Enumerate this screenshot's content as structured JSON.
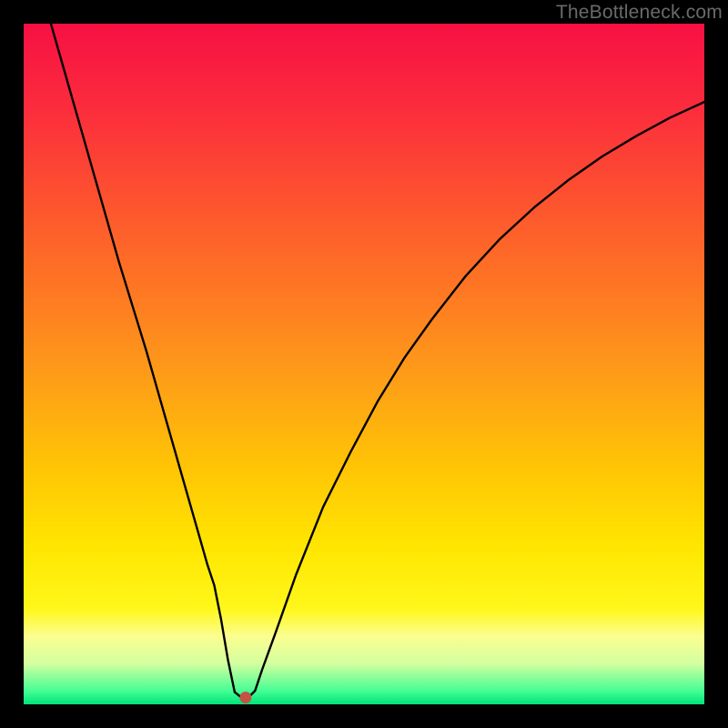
{
  "watermark": {
    "text": "TheBottleneck.com"
  },
  "chart_data": {
    "type": "line",
    "title": "",
    "xlabel": "",
    "ylabel": "",
    "xlim": [
      0,
      100
    ],
    "ylim": [
      0,
      100
    ],
    "grid": false,
    "series": [
      {
        "name": "curve",
        "x": [
          4,
          6,
          8,
          10,
          12,
          14,
          16,
          18,
          20,
          22,
          24,
          26,
          27,
          28,
          29,
          30,
          31,
          32,
          33,
          34,
          35,
          37,
          40,
          44,
          48,
          52,
          56,
          60,
          65,
          70,
          75,
          80,
          85,
          90,
          95,
          100
        ],
        "values": [
          100,
          93,
          86,
          79,
          72,
          65,
          58.5,
          52,
          45,
          38,
          31,
          24,
          20.5,
          17.5,
          12.5,
          6.6,
          1.8,
          1.0,
          1.0,
          2.0,
          5.0,
          10.5,
          19,
          29,
          37,
          44.5,
          51,
          56.6,
          63,
          68.4,
          73,
          77,
          80.5,
          83.5,
          86.2,
          88.5
        ]
      }
    ],
    "marker": {
      "x": 32.6,
      "y": 1.0,
      "color": "#c35445"
    },
    "background_gradient": {
      "direction": "vertical",
      "stops": [
        {
          "pos": 0.0,
          "color": "#f71043"
        },
        {
          "pos": 0.5,
          "color": "#fe971a"
        },
        {
          "pos": 0.77,
          "color": "#ffe601"
        },
        {
          "pos": 1.0,
          "color": "#00e47a"
        }
      ]
    }
  }
}
